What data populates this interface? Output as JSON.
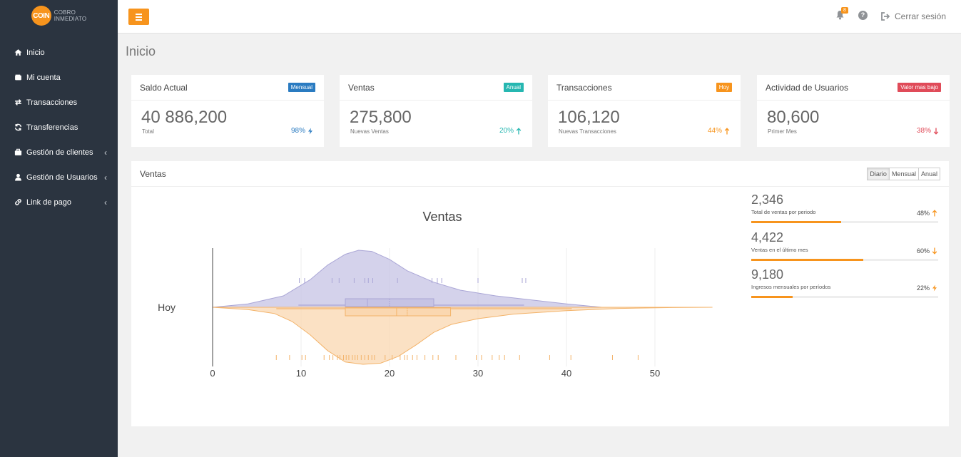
{
  "brand": {
    "logo_text": "COIN",
    "line1": "Cobro",
    "line2": "Inmediato"
  },
  "sidebar": {
    "items": [
      {
        "label": "Inicio",
        "icon": "home-icon",
        "has_chevron": false
      },
      {
        "label": "Mi cuenta",
        "icon": "wallet-icon",
        "has_chevron": false
      },
      {
        "label": "Transacciones",
        "icon": "exchange-icon",
        "has_chevron": false
      },
      {
        "label": "Transferencias",
        "icon": "refresh-icon",
        "has_chevron": false
      },
      {
        "label": "Gestión de clientes",
        "icon": "briefcase-icon",
        "has_chevron": true
      },
      {
        "label": "Gestión de Usuarios",
        "icon": "user-icon",
        "has_chevron": true
      },
      {
        "label": "Link de pago",
        "icon": "link-icon",
        "has_chevron": true
      }
    ]
  },
  "topbar": {
    "notifications_count": "8",
    "help_label": "?",
    "logout_label": "Cerrar sesión"
  },
  "page": {
    "title": "Inicio"
  },
  "cards": [
    {
      "title": "Saldo Actual",
      "badge": "Mensual",
      "badge_color": "#2a7bc1",
      "value": "40 886,200",
      "subtitle": "Total",
      "pct": "98%",
      "pct_color": "#2a7bc1",
      "pct_icon": "bolt-icon"
    },
    {
      "title": "Ventas",
      "badge": "Anual",
      "badge_color": "#26b7b1",
      "value": "275,800",
      "subtitle": "Nuevas Ventas",
      "pct": "20%",
      "pct_color": "#26b7b1",
      "pct_icon": "arrow-up-icon"
    },
    {
      "title": "Transacciones",
      "badge": "Hoy",
      "badge_color": "#f7941d",
      "value": "106,120",
      "subtitle": "Nuevas Transacciones",
      "pct": "44%",
      "pct_color": "#f7941d",
      "pct_icon": "arrow-up-icon"
    },
    {
      "title": "Actividad de Usuarios",
      "badge": "Valor mas bajo",
      "badge_color": "#e04b59",
      "value": "80,600",
      "subtitle": "Primer Mes",
      "pct": "38%",
      "pct_color": "#e04b59",
      "pct_icon": "arrow-down-icon"
    }
  ],
  "sales_panel": {
    "title": "Ventas",
    "tabs": [
      "Diario",
      "Mensual",
      "Anual"
    ],
    "active_tab": "Diario",
    "stats": [
      {
        "value": "2,346",
        "label": "Total de ventas por periodo",
        "pct": "48%",
        "progress": 0.48,
        "icon": "arrow-up-icon",
        "icon_color": "#f7941d"
      },
      {
        "value": "4,422",
        "label": "Ventas en el último mes",
        "pct": "60%",
        "progress": 0.6,
        "icon": "arrow-down-icon",
        "icon_color": "#f7941d"
      },
      {
        "value": "9,180",
        "label": "Ingresos mensuales por períodos",
        "pct": "22%",
        "progress": 0.22,
        "icon": "bolt-icon",
        "icon_color": "#f7941d"
      }
    ]
  },
  "chart_data": {
    "type": "violin",
    "title": "Ventas",
    "category": "Hoy",
    "xlim": [
      0,
      57
    ],
    "xticks": [
      0,
      10,
      20,
      30,
      40,
      50
    ],
    "grid": true,
    "series": [
      {
        "side": "upper",
        "color": "#c6c3e4",
        "stroke": "#aaa6d6",
        "density": [
          [
            0,
            0.0
          ],
          [
            4,
            0.06
          ],
          [
            8,
            0.2
          ],
          [
            11,
            0.48
          ],
          [
            13,
            0.74
          ],
          [
            15,
            0.93
          ],
          [
            16.5,
            1.0
          ],
          [
            18,
            0.98
          ],
          [
            20,
            0.84
          ],
          [
            22,
            0.64
          ],
          [
            25,
            0.44
          ],
          [
            28,
            0.3
          ],
          [
            32,
            0.2
          ],
          [
            36,
            0.13
          ],
          [
            40,
            0.06
          ],
          [
            44,
            0.0
          ]
        ],
        "box": {
          "q1": 15.0,
          "median": 17.5,
          "mean": 20.0,
          "q3": 25.0,
          "whisker_low": 9.7,
          "whisker_high": 35.2
        },
        "points": [
          9.8,
          10.4,
          13.5,
          14.3,
          16.0,
          17.2,
          17.6,
          18.1,
          20.9,
          24.8,
          25.4,
          25.9,
          30.0,
          35.0,
          35.4
        ]
      },
      {
        "side": "lower",
        "color": "#fad7b0",
        "stroke": "#f3b36a",
        "density": [
          [
            0,
            0.0
          ],
          [
            4,
            0.04
          ],
          [
            7,
            0.11
          ],
          [
            9,
            0.25
          ],
          [
            11,
            0.48
          ],
          [
            13,
            0.76
          ],
          [
            15,
            0.96
          ],
          [
            17,
            1.0
          ],
          [
            19,
            0.98
          ],
          [
            21,
            0.86
          ],
          [
            23,
            0.66
          ],
          [
            25,
            0.44
          ],
          [
            27,
            0.3
          ],
          [
            30,
            0.2
          ],
          [
            34,
            0.12
          ],
          [
            40,
            0.06
          ],
          [
            46,
            0.02
          ],
          [
            52,
            0.005
          ],
          [
            56.5,
            0.0
          ]
        ],
        "box": {
          "q1": 15.0,
          "median": 20.8,
          "mean": 22.0,
          "q3": 26.9,
          "whisker_low": 7.2,
          "whisker_high": 40.6
        },
        "points": [
          7.2,
          8.7,
          10.1,
          10.5,
          12.6,
          13.2,
          13.6,
          14.1,
          14.4,
          14.8,
          15.1,
          15.4,
          15.8,
          16.1,
          16.4,
          16.8,
          17.2,
          17.6,
          18.0,
          18.3,
          19.5,
          20.3,
          21.2,
          21.7,
          22.0,
          22.6,
          23.1,
          24.0,
          24.9,
          25.5,
          27.5,
          29.8,
          30.4,
          31.6,
          32.4,
          33.0,
          34.7,
          38.1,
          40.5,
          45.2,
          48.1
        ]
      }
    ]
  }
}
